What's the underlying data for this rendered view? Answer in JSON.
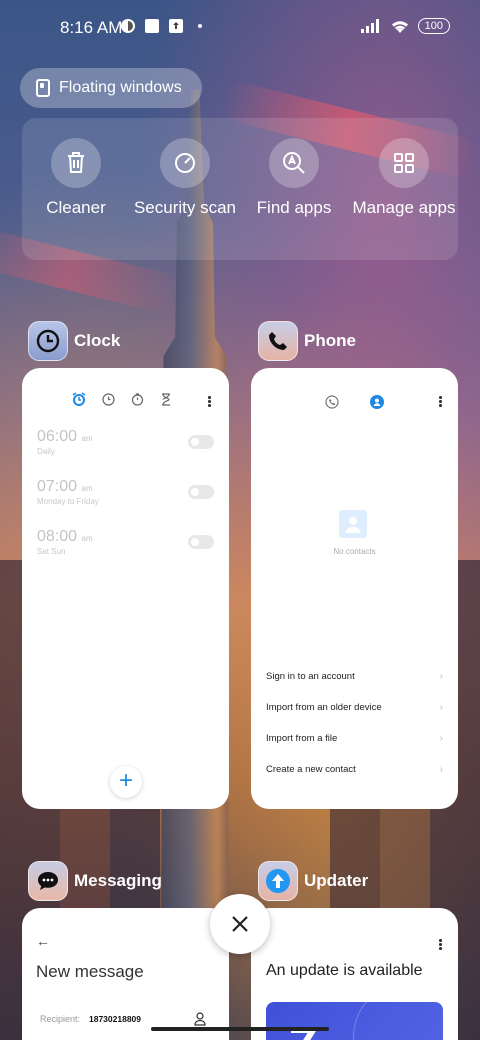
{
  "status_bar": {
    "time": "8:16 AM",
    "battery": "100"
  },
  "floating_windows": {
    "label": "Floating windows"
  },
  "tools": [
    {
      "label": "Cleaner",
      "icon": "trash-icon"
    },
    {
      "label": "Security scan",
      "icon": "security-gauge-icon"
    },
    {
      "label": "Find apps",
      "icon": "search-apps-icon"
    },
    {
      "label": "Manage apps",
      "icon": "grid-icon"
    }
  ],
  "apps": {
    "clock": {
      "name": "Clock",
      "alarms": [
        {
          "time": "06:00",
          "ampm": "am",
          "repeat": "Daily"
        },
        {
          "time": "07:00",
          "ampm": "am",
          "repeat": "Monday to Friday"
        },
        {
          "time": "08:00",
          "ampm": "am",
          "repeat": "Sat Sun"
        }
      ],
      "add_label": "+"
    },
    "phone": {
      "name": "Phone",
      "empty_text": "No contacts",
      "actions": [
        "Sign in to an account",
        "Import from an older device",
        "Import from a file",
        "Create a new contact"
      ]
    },
    "messaging": {
      "name": "Messaging",
      "title": "New message",
      "recipient_label": "Recipient:",
      "recipient_value": "18730218809"
    },
    "updater": {
      "name": "Updater",
      "title": "An update is available"
    }
  },
  "colors": {
    "accent_blue": "#1e88e5",
    "updater_blue": "#3f51d8"
  }
}
